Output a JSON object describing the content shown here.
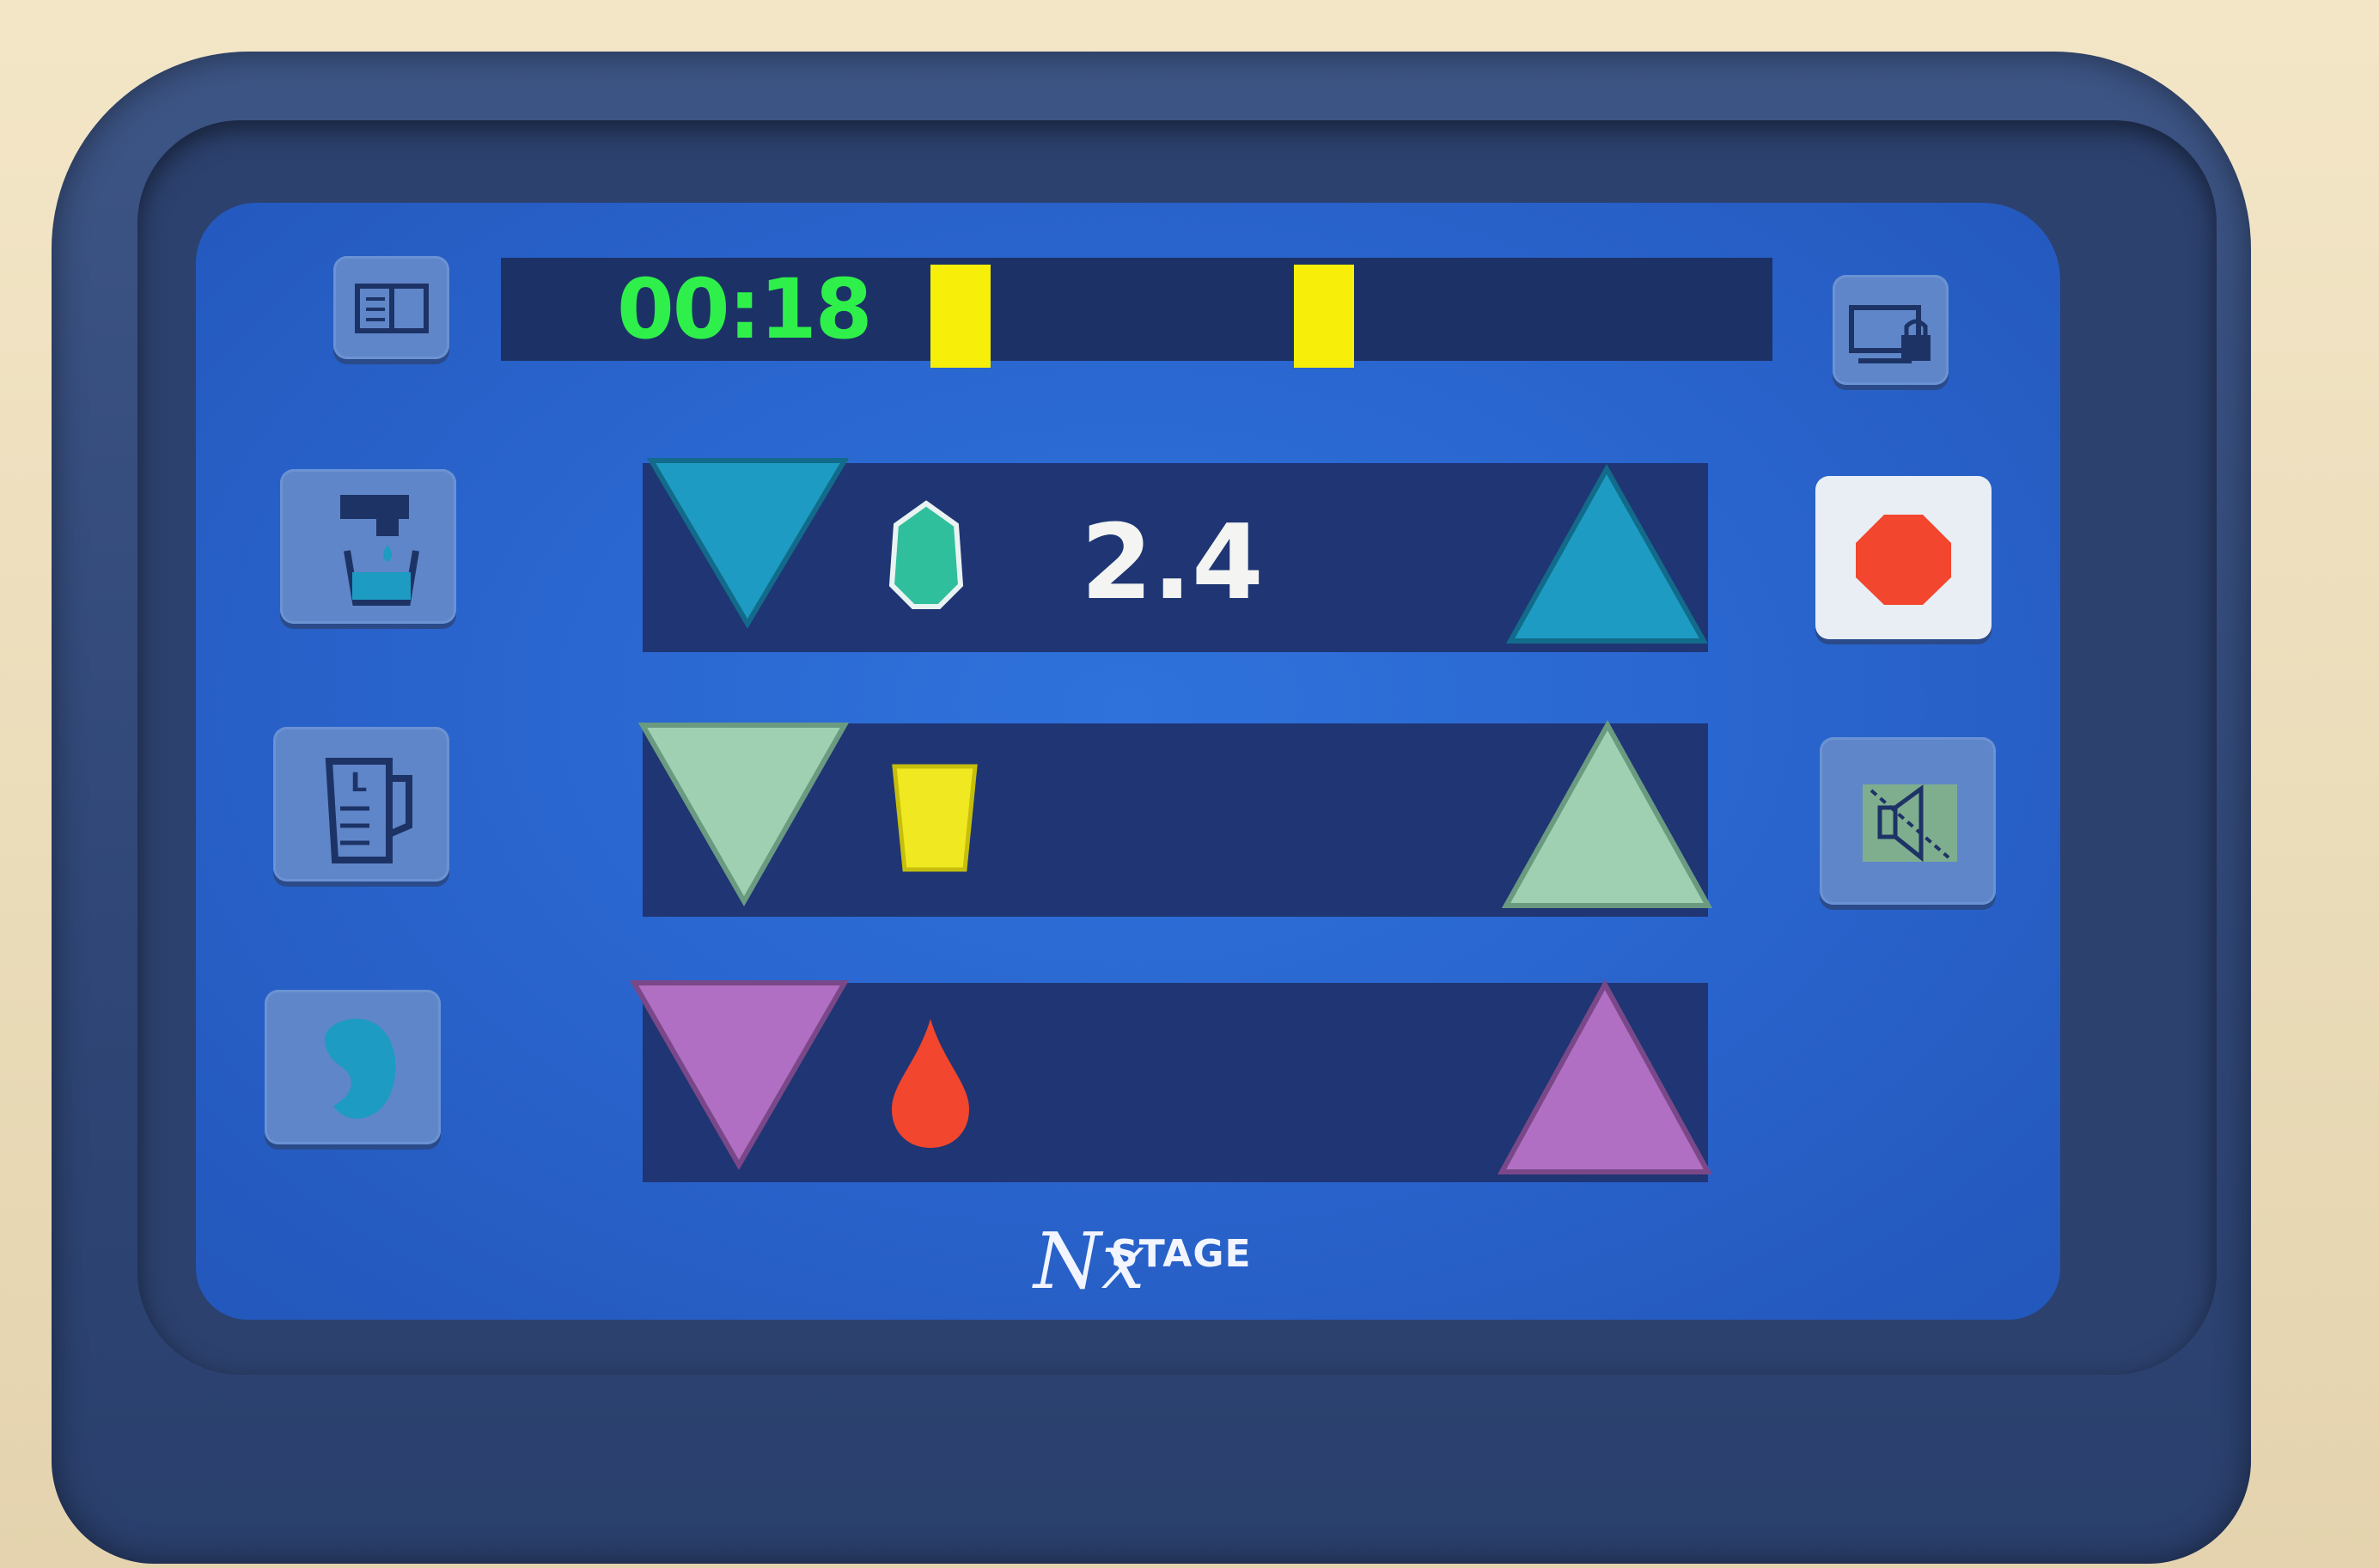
{
  "status": {
    "timer": "00:18",
    "indicators": [
      {
        "name": "indicator-1",
        "color": "#f7ef0a"
      },
      {
        "name": "indicator-2",
        "color": "#f7ef0a"
      }
    ]
  },
  "left_buttons": [
    {
      "name": "manual-button",
      "icon": "book-icon"
    },
    {
      "name": "fluid-prime-button",
      "icon": "faucet-cup-icon"
    },
    {
      "name": "volume-button",
      "icon": "measuring-jug-icon"
    },
    {
      "name": "kidney-button",
      "icon": "kidney-icon"
    }
  ],
  "right_buttons": [
    {
      "name": "screen-lock-button",
      "icon": "screen-lock-icon"
    },
    {
      "name": "stop-button",
      "icon": "stop-octagon-icon",
      "color": "#f2462e"
    },
    {
      "name": "mute-alarm-button",
      "icon": "speaker-mute-icon"
    }
  ],
  "controls": [
    {
      "name": "dialysate-fluid",
      "icon": "fluid-bag-icon",
      "value": "2.4",
      "color": "#1e9bc2"
    },
    {
      "name": "ultrafiltration",
      "icon": "cup-icon",
      "value": "",
      "color": "#9fd0b2"
    },
    {
      "name": "blood-flow",
      "icon": "blood-drop-icon",
      "value": "",
      "color": "#b06fc3"
    }
  ],
  "brand": {
    "mark": "Nx",
    "name": "STAGE"
  }
}
